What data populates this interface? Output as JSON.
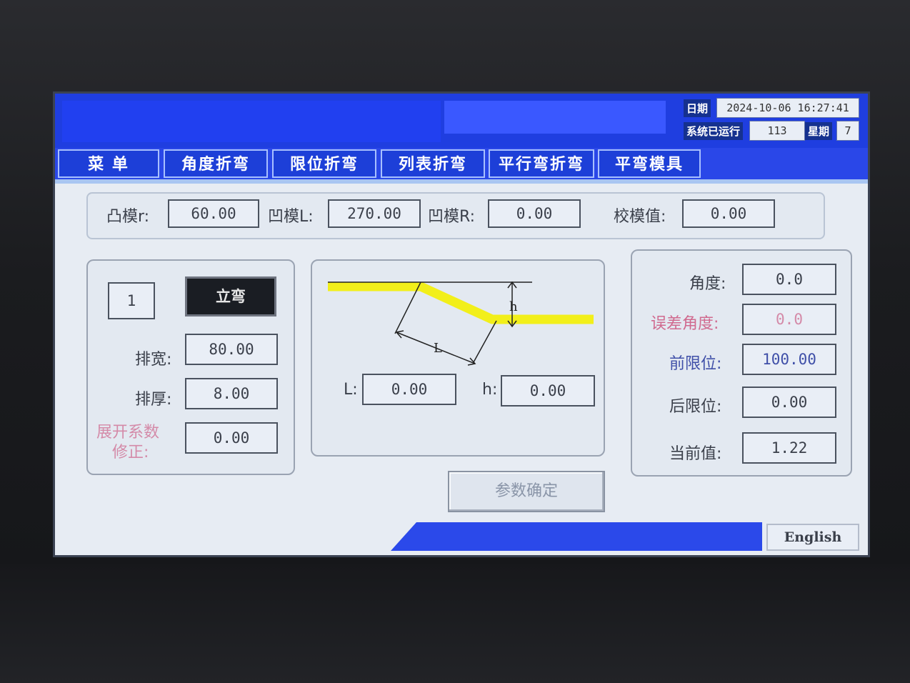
{
  "header": {
    "date_label": "日期",
    "date_value": "2024-10-06 16:27:41",
    "run_label": "系统已运行",
    "run_value": "113",
    "week_label": "星期",
    "week_value": "7"
  },
  "tabs": [
    {
      "label": "菜  单"
    },
    {
      "label": "角度折弯"
    },
    {
      "label": "限位折弯"
    },
    {
      "label": "列表折弯"
    },
    {
      "label": "平行弯折弯"
    },
    {
      "label": "平弯模具"
    }
  ],
  "die": {
    "punch_r_label": "凸模r:",
    "punch_r_value": "60.00",
    "die_l_label": "凹模L:",
    "die_l_value": "270.00",
    "die_r_label": "凹模R:",
    "die_r_value": "0.00",
    "calib_label": "校模值:",
    "calib_value": "0.00"
  },
  "left_panel": {
    "step_value": "1",
    "mode_label": "立弯",
    "width_label": "排宽:",
    "width_value": "80.00",
    "thick_label": "排厚:",
    "thick_value": "8.00",
    "coef_label_line1": "展开系数",
    "coef_label_line2": "修正:",
    "coef_value": "0.00"
  },
  "diagram": {
    "h_mark": "h",
    "l_mark": "L",
    "l_label": "L:",
    "l_value": "0.00",
    "h_label": "h:",
    "h_value": "0.00"
  },
  "right_panel": {
    "angle_label": "角度:",
    "angle_value": "0.0",
    "err_label": "误差角度:",
    "err_value": "0.0",
    "front_label": "前限位:",
    "front_value": "100.00",
    "rear_label": "后限位:",
    "rear_value": "0.00",
    "current_label": "当前值:",
    "current_value": "1.22"
  },
  "confirm_label": "参数确定",
  "footer": {
    "english_label": "English"
  },
  "colors": {
    "header_blue": "#1f3ee0",
    "tab_blue": "#1d3fd8",
    "busbar_yellow": "#f2ef1a",
    "error_pink": "#d06a8f",
    "accent_navy": "#3f4fa8"
  }
}
